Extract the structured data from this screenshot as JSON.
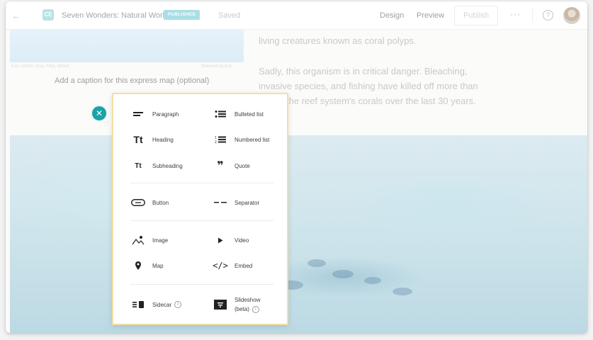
{
  "header": {
    "story_title": "Seven Wonders: Natural World",
    "badge": "PUBLISHED",
    "saved": "Saved",
    "nav_design": "Design",
    "nav_preview": "Preview",
    "publish": "Publish",
    "more": "···",
    "help": "?",
    "logo_text": "CE"
  },
  "content": {
    "map_attribution": "Esri, USGS | Esri, FAO, NOAA",
    "map_powered": "Powered by Esri",
    "caption_placeholder": "Add a caption for this express map (optional)",
    "paragraph_1": "living creatures known as coral polyps.",
    "paragraph_2": "Sadly, this organism is in critical danger. Bleaching, invasive species, and fishing have killed off more than half of the reef system's corals over the last 30 years."
  },
  "block_menu": {
    "items": [
      {
        "label": "Paragraph",
        "icon": "paragraph-icon"
      },
      {
        "label": "Bulleted list",
        "icon": "bulleted-list-icon"
      },
      {
        "label": "Heading",
        "icon": "heading-icon"
      },
      {
        "label": "Numbered list",
        "icon": "numbered-list-icon"
      },
      {
        "label": "Subheading",
        "icon": "subheading-icon"
      },
      {
        "label": "Quote",
        "icon": "quote-icon"
      },
      {
        "label": "Button",
        "icon": "button-icon"
      },
      {
        "label": "Separator",
        "icon": "separator-icon"
      },
      {
        "label": "Image",
        "icon": "image-icon"
      },
      {
        "label": "Video",
        "icon": "video-icon"
      },
      {
        "label": "Map",
        "icon": "map-icon"
      },
      {
        "label": "Embed",
        "icon": "embed-icon"
      },
      {
        "label": "Sidecar",
        "icon": "sidecar-icon"
      },
      {
        "label": "Slideshow",
        "label2": "(beta)",
        "icon": "slideshow-icon"
      }
    ],
    "info_glyph": "i"
  },
  "colors": {
    "accent": "#1aa3a8",
    "menu_border": "#f3dfa6",
    "badge": "#a9dfe4"
  }
}
